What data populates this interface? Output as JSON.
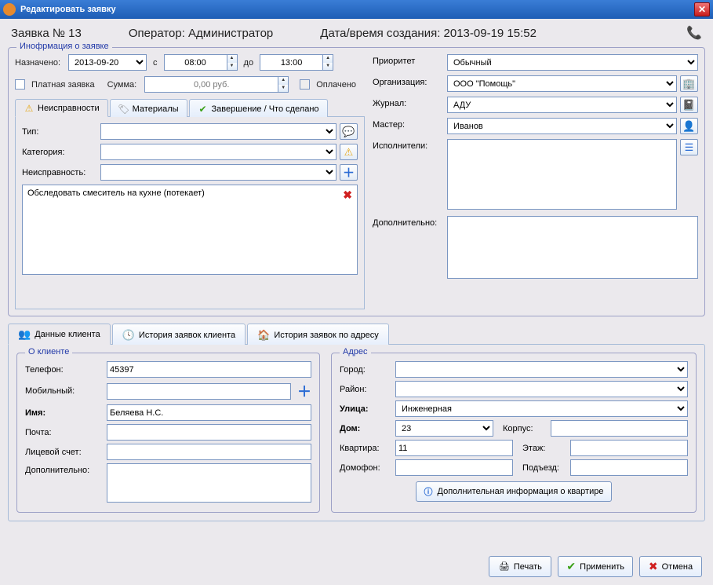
{
  "titlebar": {
    "title": "Редактировать заявку"
  },
  "header": {
    "order_no": "Заявка № 13",
    "operator": "Оператор: Администратор",
    "created": "Дата/время создания: 2013-09-19 15:52"
  },
  "order_info": {
    "legend": "Инофрмация о заявке",
    "assigned_label": "Назначено:",
    "date": "2013-09-20",
    "from_label": "с",
    "time_from": "08:00",
    "to_label": "до",
    "time_to": "13:00",
    "paid_label": "Платная заявка",
    "sum_label": "Сумма:",
    "sum_value": "0,00 руб.",
    "paid_done_label": "Оплачено"
  },
  "tabs": {
    "faults": "Неисправности",
    "materials": "Материалы",
    "completion": "Завершение / Что сделано"
  },
  "faults": {
    "type_label": "Тип:",
    "category_label": "Категория:",
    "fault_label": "Неисправность:",
    "items": [
      {
        "text": "Обследовать смеситель на кухне (потекает)"
      }
    ]
  },
  "right": {
    "priority_label": "Приоритет",
    "priority_value": "Обычный",
    "org_label": "Организация:",
    "org_value": "ООО \"Помощь\"",
    "journal_label": "Журнал:",
    "journal_value": "АДУ",
    "master_label": "Мастер:",
    "master_value": "Иванов",
    "performers_label": "Исполнители:",
    "additional_label": "Дополнительно:"
  },
  "client_tabs": {
    "data": "Данные клиента",
    "history_client": "История заявок клиента",
    "history_addr": "История заявок по адресу"
  },
  "about_client": {
    "legend": "О клиенте",
    "phone_label": "Телефон:",
    "phone_value": "45397",
    "mobile_label": "Мобильный:",
    "name_label": "Имя:",
    "name_value": "Беляева Н.С.",
    "mail_label": "Почта:",
    "account_label": "Лицевой счет:",
    "additional_label": "Дополнительно:"
  },
  "address": {
    "legend": "Адрес",
    "city_label": "Город:",
    "district_label": "Район:",
    "street_label": "Улица:",
    "street_value": "Инженерная",
    "house_label": "Дом:",
    "house_value": "23",
    "corp_label": "Корпус:",
    "flat_label": "Квартира:",
    "flat_value": "11",
    "floor_label": "Этаж:",
    "intercom_label": "Домофон:",
    "entry_label": "Подъезд:",
    "info_btn": "Дополнительная информация о квартире"
  },
  "footer": {
    "print": "Печать",
    "apply": "Применить",
    "cancel": "Отмена"
  }
}
